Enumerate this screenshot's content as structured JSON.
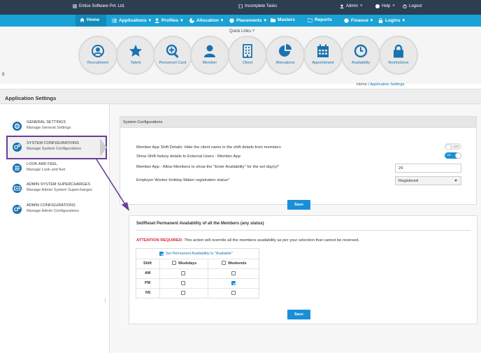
{
  "topbar": {
    "company": "Entice Software Pvt. Ltd.",
    "incomplete_tasks": "Incomplete Tasks",
    "admin": "Admin",
    "help": "Help",
    "logout": "Logout"
  },
  "nav": {
    "items": [
      {
        "label": "Home",
        "icon": "home-icon"
      },
      {
        "label": "Applications",
        "icon": "list-icon"
      },
      {
        "label": "Profiles",
        "icon": "user-icon"
      },
      {
        "label": "Allocation",
        "icon": "pie-icon"
      },
      {
        "label": "Placements",
        "icon": "globe-icon"
      },
      {
        "label": "Masters",
        "icon": "folder-icon"
      },
      {
        "label": "Reports",
        "icon": "folder-open-icon"
      },
      {
        "label": "Finance",
        "icon": "globe-icon"
      },
      {
        "label": "Logins",
        "icon": "lock-icon"
      }
    ]
  },
  "quicklinks": {
    "title": "Quick Links",
    "items": [
      {
        "label": "Recruitment",
        "icon": "person-circle-icon"
      },
      {
        "label": "Talent",
        "icon": "star-icon"
      },
      {
        "label": "Personnel Card",
        "icon": "search-plus-icon"
      },
      {
        "label": "Member",
        "icon": "user-icon"
      },
      {
        "label": "Client",
        "icon": "building-icon"
      },
      {
        "label": "Allocations",
        "icon": "pie-chart-icon"
      },
      {
        "label": "Appointment",
        "icon": "calendar-icon"
      },
      {
        "label": "Availability",
        "icon": "clock-icon"
      },
      {
        "label": "Restrictions",
        "icon": "lock-icon"
      }
    ]
  },
  "currency_symbol": "$",
  "breadcrumb": {
    "home": "Home",
    "separator": "\\",
    "current": "Application Settings"
  },
  "page_title": "Application Settings",
  "sidebar": {
    "items": [
      {
        "title": "GENERAL SETTINGS",
        "subtitle": "Manage General Settings",
        "icon": "gear-icon"
      },
      {
        "title": "SYSTEM CONFIGURATIONS",
        "subtitle": "Manage System Configurations",
        "icon": "gears-icon"
      },
      {
        "title": "LOOK AND FEEL",
        "subtitle": "Manage Look and feel",
        "icon": "list-icon"
      },
      {
        "title": "ADMIN SYSTEM SUPERCHARGES",
        "subtitle": "Manage Admin System Supercharges",
        "icon": "keyboard-icon"
      },
      {
        "title": "ADMIN CONFIGURATIONS",
        "subtitle": "Manage Admin Configurations",
        "icon": "gears-icon"
      }
    ]
  },
  "system_config": {
    "header": "System Configurations",
    "rows": {
      "hide_client": "Member App Shift Details: Hide the client name in the shift details from members",
      "show_history": "Show Shift history details to External Users - Member App",
      "allow_members": "Member App - Allow Members to show the \"Enter Availability\" for the set day(s)*",
      "holiday_status": "Employer Worker Holiday Maker registration status*"
    },
    "toggle_off_text": "OFF",
    "toggle_on_text": "ON",
    "days_value": "29",
    "status_value": "Registered",
    "save_label": "Save"
  },
  "availability": {
    "title": "Set/Reset Permanent Availability of all the Members (any status)",
    "attention_label": "ATTENTION REQUIRED:",
    "attention_text": " This action will override all the members availability as per your selection that cannot be reversed.",
    "set_label": "Set Permanent Availability to \"Available\"",
    "col_shift": "Shift",
    "col_weekdays": "Weekdays",
    "col_weekends": "Weekends",
    "rows": [
      {
        "shift": "AM",
        "weekdays": false,
        "weekends": false
      },
      {
        "shift": "PM",
        "weekdays": false,
        "weekends": true
      },
      {
        "shift": "NS",
        "weekdays": false,
        "weekends": false
      }
    ],
    "save_label": "Save"
  },
  "colors": {
    "accent": "#1aa1d5",
    "dark_bar": "#2c3e50",
    "brand_blue": "#1a72b0",
    "highlight": "#6a3d9a",
    "attention_red": "#d62728"
  }
}
